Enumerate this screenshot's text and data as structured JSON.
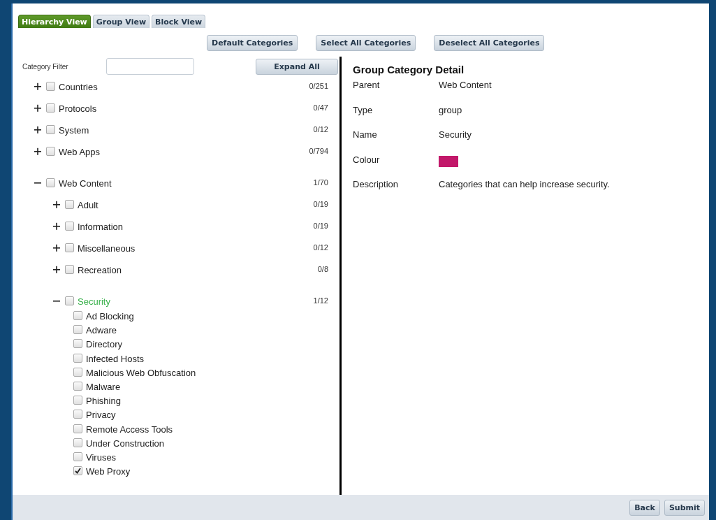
{
  "tabs": [
    {
      "label": "Hierarchy View",
      "selected": true
    },
    {
      "label": "Group View",
      "selected": false
    },
    {
      "label": "Block View",
      "selected": false
    }
  ],
  "actions": [
    "Default Categories",
    "Select All Categories",
    "Deselect All Categories"
  ],
  "filter": {
    "label": "Category Filter"
  },
  "expand_button": "Expand All",
  "tree": [
    {
      "label": "Countries",
      "count": "0/251",
      "expanded": false,
      "checked": false,
      "selected": false
    },
    {
      "label": "Protocols",
      "count": "0/47",
      "expanded": false,
      "checked": false,
      "selected": false
    },
    {
      "label": "System",
      "count": "0/12",
      "expanded": false,
      "checked": false,
      "selected": false
    },
    {
      "label": "Web Apps",
      "count": "0/794",
      "expanded": false,
      "checked": false,
      "selected": false
    },
    {
      "label": "Web Content",
      "count": "1/70",
      "expanded": true,
      "checked": false,
      "selected": false,
      "children": [
        {
          "label": "Adult",
          "count": "0/19",
          "expanded": false,
          "checked": false,
          "selected": false
        },
        {
          "label": "Information",
          "count": "0/19",
          "expanded": false,
          "checked": false,
          "selected": false
        },
        {
          "label": "Miscellaneous",
          "count": "0/12",
          "expanded": false,
          "checked": false,
          "selected": false
        },
        {
          "label": "Recreation",
          "count": "0/8",
          "expanded": false,
          "checked": false,
          "selected": false
        },
        {
          "label": "Security",
          "count": "1/12",
          "expanded": true,
          "checked": false,
          "selected": true,
          "children": [
            {
              "label": "Ad Blocking",
              "checked": false
            },
            {
              "label": "Adware",
              "checked": false
            },
            {
              "label": "Directory",
              "checked": false
            },
            {
              "label": "Infected Hosts",
              "checked": false
            },
            {
              "label": "Malicious Web Obfuscation",
              "checked": false
            },
            {
              "label": "Malware",
              "checked": false
            },
            {
              "label": "Phishing",
              "checked": false
            },
            {
              "label": "Privacy",
              "checked": false
            },
            {
              "label": "Remote Access Tools",
              "checked": false
            },
            {
              "label": "Under Construction",
              "checked": false
            },
            {
              "label": "Viruses",
              "checked": false
            },
            {
              "label": "Web Proxy",
              "checked": true
            }
          ]
        }
      ]
    }
  ],
  "detail": {
    "title": "Group Category Detail",
    "fields": [
      {
        "label": "Parent",
        "kind": "text",
        "value": "Web Content"
      },
      {
        "label": "Type",
        "kind": "text",
        "value": "group"
      },
      {
        "label": "Name",
        "kind": "text",
        "value": "Security"
      },
      {
        "label": "Colour",
        "kind": "swatch",
        "color": "#c2186a"
      },
      {
        "label": "Description",
        "kind": "text",
        "value": "Categories that can help increase security."
      }
    ]
  },
  "footer_buttons": [
    "Back",
    "Submit"
  ]
}
